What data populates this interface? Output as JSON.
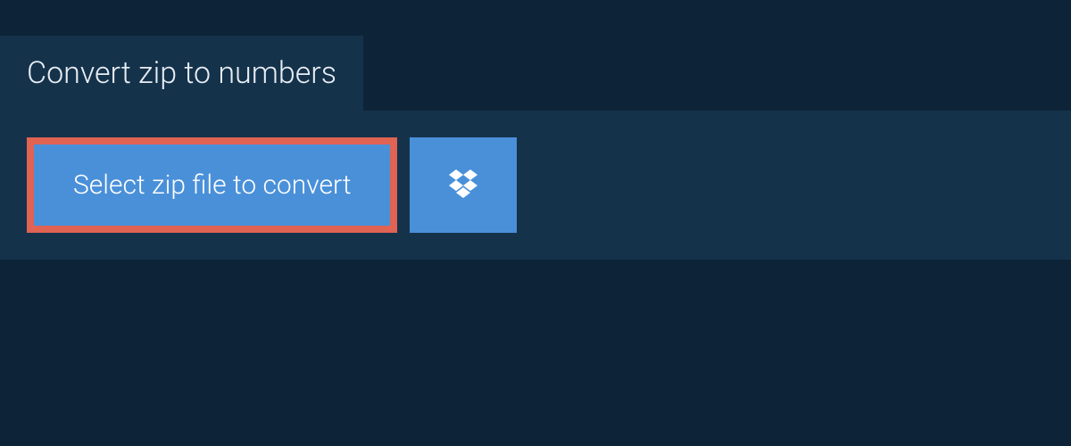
{
  "header": {
    "title": "Convert zip to numbers"
  },
  "actions": {
    "select_label": "Select zip file to convert",
    "dropbox_icon": "dropbox-icon"
  },
  "colors": {
    "page_bg": "#0d2438",
    "panel_bg": "#15324b",
    "button_bg": "#4a90d9",
    "highlight_border": "#e06354",
    "text_light": "#ffffff"
  }
}
